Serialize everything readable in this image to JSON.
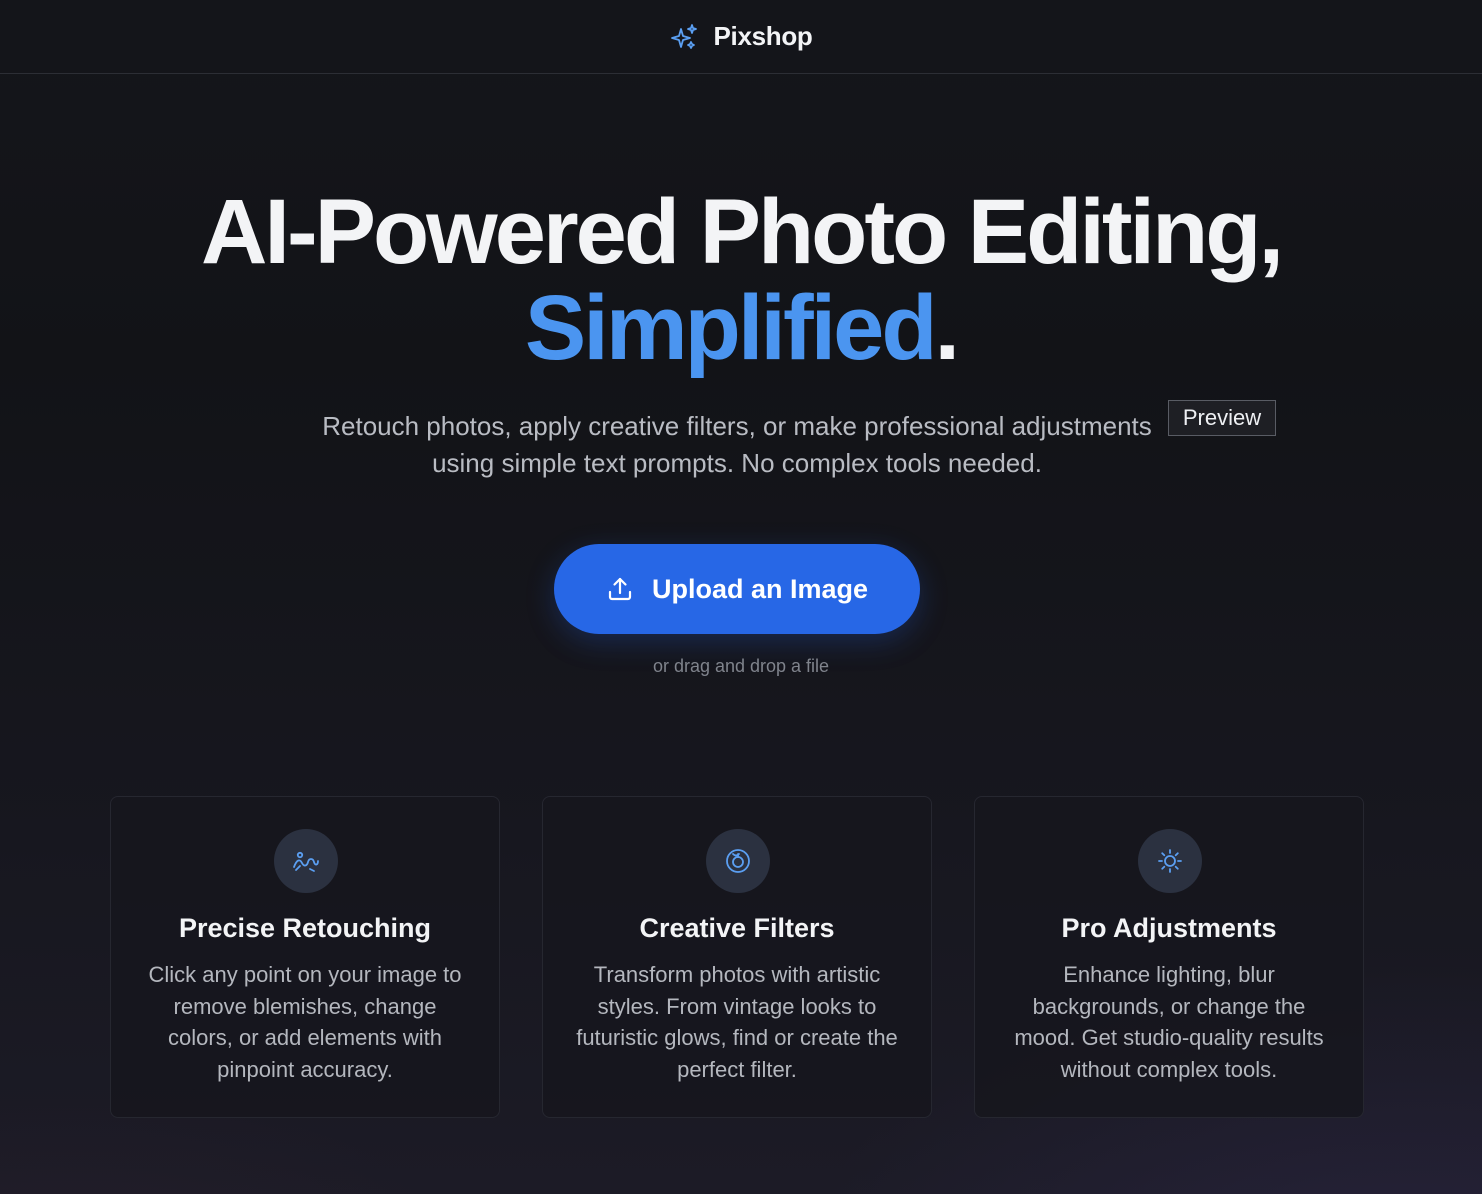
{
  "app": {
    "name": "Pixshop",
    "logo_icon": "sparkles-icon"
  },
  "hero": {
    "title_main": "AI-Powered Photo Editing,",
    "title_accent": "Simplified",
    "title_end": ".",
    "subtitle": "Retouch photos, apply creative filters, or make professional adjustments using simple text prompts. No complex tools needed."
  },
  "preview_badge": "Preview",
  "upload": {
    "label": "Upload an Image",
    "icon": "upload-icon",
    "hint": "or drag and drop a file"
  },
  "features": [
    {
      "icon": "magic-wand-icon",
      "title": "Precise Retouching",
      "description": "Click any point on your image to remove blemishes, change colors, or add elements with pinpoint accuracy."
    },
    {
      "icon": "palette-icon",
      "title": "Creative Filters",
      "description": "Transform photos with artistic styles. From vintage looks to futuristic glows, find or create the perfect filter."
    },
    {
      "icon": "sun-icon",
      "title": "Pro Adjustments",
      "description": "Enhance lighting, blur backgrounds, or change the mood. Get studio-quality results without complex tools."
    }
  ],
  "colors": {
    "accent": "#4b95f0",
    "button": "#2767e6",
    "background": "#121317",
    "card": "#16161d"
  }
}
